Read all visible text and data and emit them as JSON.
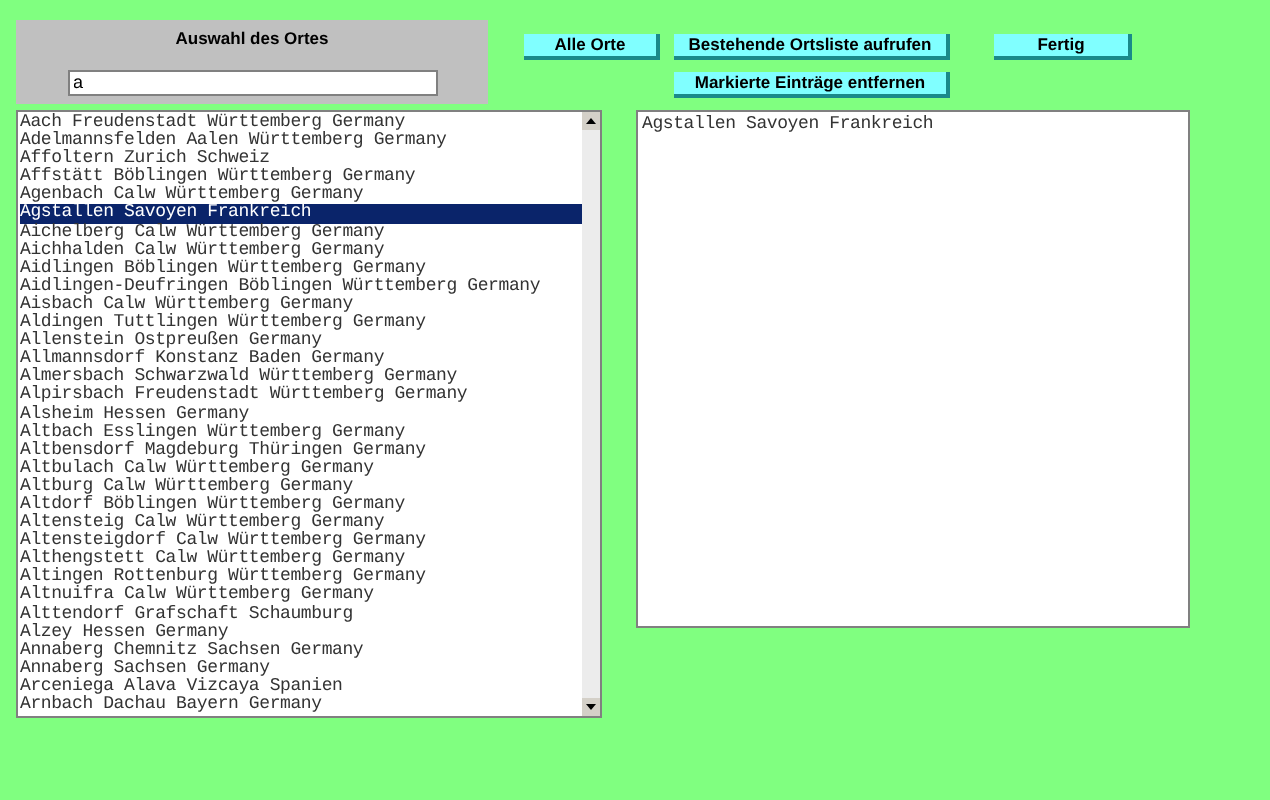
{
  "selection_panel": {
    "title": "Auswahl des Ortes",
    "search": {
      "value": "a"
    }
  },
  "buttons": [
    {
      "label": "Alle Orte",
      "kind": "top"
    },
    {
      "label": "Bestehende Ortsliste aufrufen",
      "kind": "top"
    },
    {
      "label": "Fertig",
      "kind": "top"
    },
    {
      "label": "Markierte Einträge entfernen",
      "kind": "bottom"
    }
  ],
  "places": [
    {
      "label": "Aach Freudenstadt Württemberg Germany",
      "selected": false
    },
    {
      "label": "Adelmannsfelden Aalen Württemberg Germany",
      "selected": false
    },
    {
      "label": "Affoltern Zurich Schweiz",
      "selected": false
    },
    {
      "label": "Affstätt Böblingen Württemberg Germany",
      "selected": false
    },
    {
      "label": "Agenbach Calw Württemberg Germany",
      "selected": false
    },
    {
      "label": "Agstallen Savoyen Frankreich",
      "selected": true
    },
    {
      "label": "Aichelberg Calw Württemberg Germany",
      "selected": false
    },
    {
      "label": "Aichhalden Calw Württemberg Germany",
      "selected": false
    },
    {
      "label": "Aidlingen Böblingen Württemberg Germany",
      "selected": false
    },
    {
      "label": "Aidlingen-Deufringen Böblingen Württemberg Germany",
      "selected": false
    },
    {
      "label": "Aisbach Calw Württemberg Germany",
      "selected": false
    },
    {
      "label": "Aldingen Tuttlingen Württemberg Germany",
      "selected": false
    },
    {
      "label": "Allenstein Ostpreußen Germany",
      "selected": false
    },
    {
      "label": "Allmannsdorf Konstanz Baden Germany",
      "selected": false
    },
    {
      "label": "Almersbach Schwarzwald Württemberg Germany",
      "selected": false
    },
    {
      "label": "Alpirsbach Freudenstadt Württemberg Germany",
      "selected": false
    },
    {
      "label": "Alsheim Hessen Germany",
      "selected": false
    },
    {
      "label": "Altbach Esslingen Württemberg Germany",
      "selected": false
    },
    {
      "label": "Altbensdorf Magdeburg Thüringen Germany",
      "selected": false
    },
    {
      "label": "Altbulach Calw Württemberg Germany",
      "selected": false
    },
    {
      "label": "Altburg Calw Württemberg Germany",
      "selected": false
    },
    {
      "label": "Altdorf Böblingen Württemberg Germany",
      "selected": false
    },
    {
      "label": "Altensteig Calw Württemberg Germany",
      "selected": false
    },
    {
      "label": "Altensteigdorf Calw Württemberg Germany",
      "selected": false
    },
    {
      "label": "Althengstett Calw Württemberg Germany",
      "selected": false
    },
    {
      "label": "Altingen Rottenburg Württemberg Germany",
      "selected": false
    },
    {
      "label": "Altnuifra Calw Württemberg Germany",
      "selected": false
    },
    {
      "label": "Alttendorf Grafschaft Schaumburg",
      "selected": false
    },
    {
      "label": "Alzey Hessen Germany",
      "selected": false
    },
    {
      "label": "Annaberg Chemnitz Sachsen Germany",
      "selected": false
    },
    {
      "label": "Annaberg Sachsen Germany",
      "selected": false
    },
    {
      "label": "Arceniega Alava Vizcaya Spanien",
      "selected": false
    },
    {
      "label": "Arnbach Dachau Bayern Germany",
      "selected": false
    }
  ],
  "chosen_places": [
    "Agstallen Savoyen Frankreich"
  ]
}
